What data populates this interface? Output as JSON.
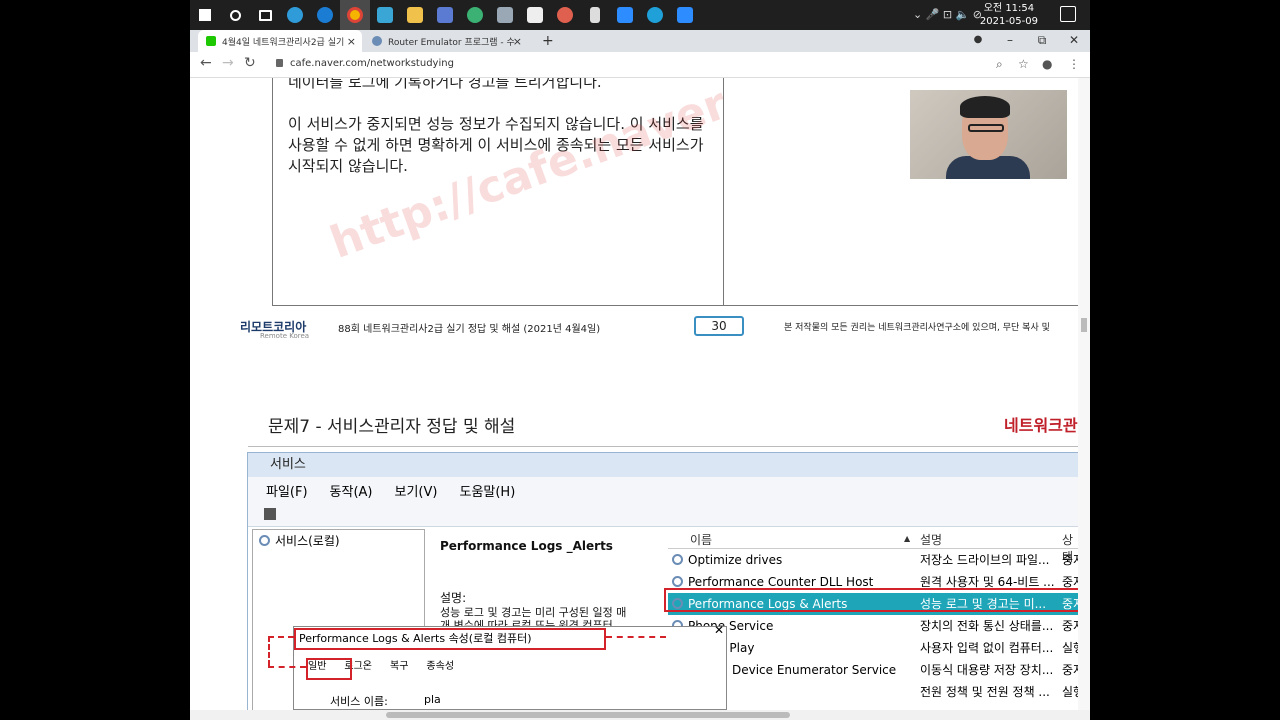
{
  "taskbar": {
    "time": "오전 11:54",
    "date": "2021-05-09",
    "tray": "⌄ 🎤 ⊡ 🔈 ⊘"
  },
  "tabs": [
    {
      "label": "4월4일 네트워크관리사2급 실기",
      "close": "×"
    },
    {
      "label": "Router Emulator 프로그램 - 수",
      "close": "×"
    }
  ],
  "new_tab": "+",
  "window_controls": {
    "minimize": "–",
    "restore": "⧉",
    "close": "✕"
  },
  "address_bar": {
    "url": "cafe.naver.com/networkstudying"
  },
  "slide": {
    "line1": "네이터를 로그에 기록하거나 경고를 트리거합니다.",
    "para": "이 서비스가 중지되면 성능 정보가 수집되지 않습니다. 이 서비스를 사용할 수 없게 하면 명확하게 이 서비스에 종속되는 모든 서비스가 시작되지 않습니다.",
    "watermark": "http://cafe.naver"
  },
  "footer": {
    "logo": "리모트코리아",
    "logo_sub": "Remote Korea",
    "exam_title": "88회 네트워크관리사2급  실기 정답 및 해설 (2021년 4월4일)",
    "page": "30",
    "copyright": "본 저작물의 모든 권리는 네트워크관리사연구소에 있으며, 무단 복사 및"
  },
  "section": {
    "title": "문제7 - 서비스관리자 정답 및 해설",
    "right": "네트워크관"
  },
  "services_window": {
    "title": "서비스",
    "menu": [
      "파일(F)",
      "동작(A)",
      "보기(V)",
      "도움말(H)"
    ],
    "tree_item": "서비스(로컬)",
    "detail_title": "Performance Logs _Alerts",
    "detail_desc_label": "설명:",
    "detail_desc": "성능 로그 및 경고는 미리 구성된 일정 매개 변수에 따라 로컬 또는 원격 컴퓨터",
    "columns": {
      "name": "이름",
      "desc": "설명",
      "status": "상태"
    },
    "rows": [
      {
        "name": "Optimize drives",
        "desc": "저장소 드라이브의 파일...",
        "status": "중지"
      },
      {
        "name": "Performance Counter DLL Host",
        "desc": "원격 사용자 및 64-비트 ...",
        "status": "중지"
      },
      {
        "name": "Performance Logs & Alerts",
        "desc": "성능 로그 및 경고는 미...",
        "status": "중지"
      },
      {
        "name": "Phone Service",
        "desc": "장치의 전화 통신 상태를...",
        "status": "중지"
      },
      {
        "name": "d Play",
        "desc": "사용자 입력 없이 컴퓨터...",
        "status": "실행"
      },
      {
        "name": "Device Enumerator Service",
        "desc": "이동식 대용량 저장 장치...",
        "status": "중지"
      },
      {
        "name": "",
        "desc": "전원 정책 및 전원 정책 ...",
        "status": "실행"
      }
    ]
  },
  "dialog": {
    "title": "Performance Logs & Alerts 속성(로컬 컴퓨터)",
    "close": "✕",
    "tabs": [
      "일반",
      "로그온",
      "복구",
      "종속성"
    ],
    "field_label": "서비스 이름:",
    "field_value": "pla"
  }
}
